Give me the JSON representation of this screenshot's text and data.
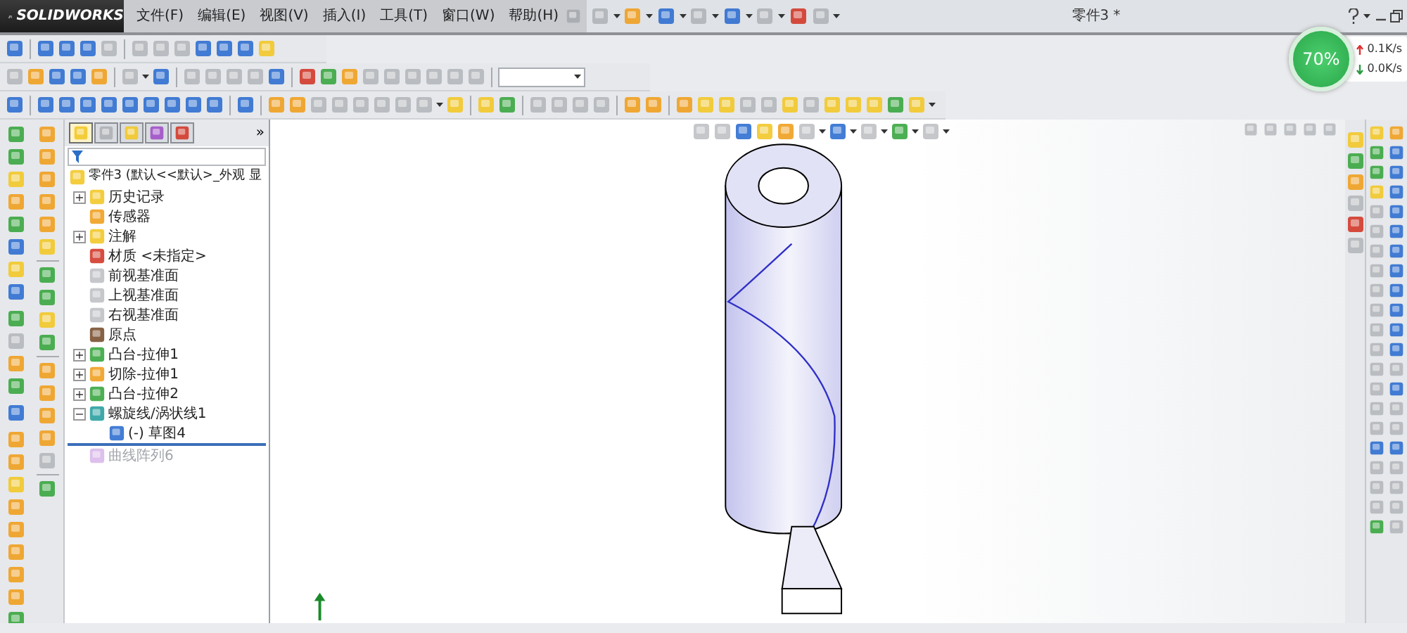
{
  "app": {
    "logo": "SOLIDWORKS"
  },
  "menu": [
    "文件(F)",
    "编辑(E)",
    "视图(V)",
    "插入(I)",
    "工具(T)",
    "窗口(W)",
    "帮助(H)"
  ],
  "title": "零件3 *",
  "network": {
    "percent": "70%",
    "upload": "0.1K/s",
    "download": "0.0K/s"
  },
  "feature_tree": {
    "tabs": [
      {
        "kind": "features",
        "selected": true
      },
      {
        "kind": "properties",
        "selected": false
      },
      {
        "kind": "config",
        "selected": false
      },
      {
        "kind": "dimxpert",
        "selected": false
      },
      {
        "kind": "display",
        "selected": false
      }
    ],
    "more": "»",
    "root": "零件3  (默认<<默认>_外观 显",
    "items": [
      {
        "label": "历史记录",
        "kind": "history",
        "toggle": "+",
        "disabled": false
      },
      {
        "label": "传感器",
        "kind": "sensor",
        "disabled": false
      },
      {
        "label": "注解",
        "kind": "annotation",
        "toggle": "+",
        "disabled": false
      },
      {
        "label": "材质 <未指定>",
        "kind": "material",
        "disabled": false
      },
      {
        "label": "前视基准面",
        "kind": "plane",
        "disabled": false
      },
      {
        "label": "上视基准面",
        "kind": "plane",
        "disabled": false
      },
      {
        "label": "右视基准面",
        "kind": "plane",
        "disabled": false
      },
      {
        "label": "原点",
        "kind": "origin",
        "disabled": false
      },
      {
        "label": "凸台-拉伸1",
        "kind": "boss",
        "toggle": "+",
        "disabled": false
      },
      {
        "label": "切除-拉伸1",
        "kind": "cut",
        "toggle": "+",
        "disabled": false
      },
      {
        "label": "凸台-拉伸2",
        "kind": "boss",
        "toggle": "+",
        "disabled": false
      },
      {
        "label": "螺旋线/涡状线1",
        "kind": "helix",
        "toggle": "−",
        "disabled": false,
        "children": [
          {
            "label": "(-) 草图4",
            "kind": "sketch",
            "disabled": false
          }
        ]
      },
      {
        "label": "曲线阵列6",
        "kind": "pattern",
        "disabled": true
      }
    ]
  }
}
